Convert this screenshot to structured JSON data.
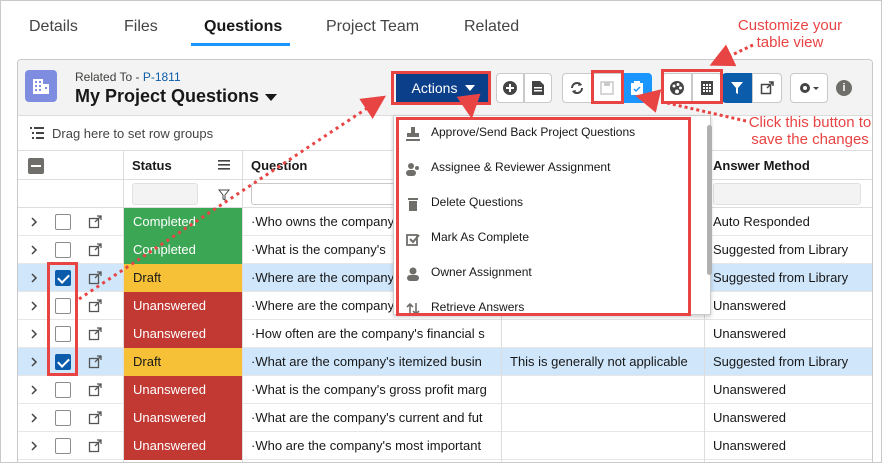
{
  "tabs": [
    "Details",
    "Files",
    "Questions",
    "Project Team",
    "Related"
  ],
  "header": {
    "related_to_label": "Related To - ",
    "related_to_link": "P-1811",
    "title": "My Project Questions",
    "actions_label": "Actions"
  },
  "rowgroup_text": "Drag here to set row groups",
  "columns": {
    "status": "Status",
    "question": "Question",
    "answer_method": "Answer Method"
  },
  "rows": [
    {
      "status": "Completed",
      "status_color": "#3ba755",
      "question": "·Who owns the company",
      "answer": "",
      "method": "Auto Responded",
      "checked": false,
      "selected": false
    },
    {
      "status": "Completed",
      "status_color": "#3ba755",
      "question": "·What is the company's",
      "answer": "",
      "method": "Suggested from Library",
      "checked": false,
      "selected": false
    },
    {
      "status": "Draft",
      "status_color": "#f7c137",
      "question": "·Where are the company",
      "answer": "",
      "method": "Suggested from Library",
      "checked": true,
      "selected": true
    },
    {
      "status": "Unanswered",
      "status_color": "#c23934",
      "question": "·Where are the company",
      "answer": "",
      "method": "Unanswered",
      "checked": false,
      "selected": false
    },
    {
      "status": "Unanswered",
      "status_color": "#c23934",
      "question": "·How often are the company's financial s",
      "answer": "",
      "method": "Unanswered",
      "checked": false,
      "selected": false
    },
    {
      "status": "Draft",
      "status_color": "#f7c137",
      "question": "·What are the company's itemized busin",
      "answer": "This is generally not applicable",
      "method": "Suggested from Library",
      "checked": true,
      "selected": true
    },
    {
      "status": "Unanswered",
      "status_color": "#c23934",
      "question": "·What is the company's gross profit marg",
      "answer": "",
      "method": "Unanswered",
      "checked": false,
      "selected": false
    },
    {
      "status": "Unanswered",
      "status_color": "#c23934",
      "question": "·What are the company's current and fut",
      "answer": "",
      "method": "Unanswered",
      "checked": false,
      "selected": false
    },
    {
      "status": "Unanswered",
      "status_color": "#c23934",
      "question": "·Who are the company's most important",
      "answer": "",
      "method": "Unanswered",
      "checked": false,
      "selected": false
    }
  ],
  "actions_menu": [
    {
      "label": "Approve/Send Back Project Questions",
      "icon": "stamp-icon"
    },
    {
      "label": "Assignee & Reviewer Assignment",
      "icon": "users-icon"
    },
    {
      "label": "Delete Questions",
      "icon": "trash-icon"
    },
    {
      "label": "Mark As Complete",
      "icon": "check-square-icon"
    },
    {
      "label": "Owner Assignment",
      "icon": "user-icon"
    },
    {
      "label": "Retrieve Answers",
      "icon": "sort-arrows-icon"
    }
  ],
  "annotations": {
    "customize": "Customize your\ntable view",
    "save": "Click this button to\nsave the changes"
  },
  "colors": {
    "brand": "#0b5cab",
    "accent": "#1b96ff",
    "annotation": "#e84444"
  }
}
